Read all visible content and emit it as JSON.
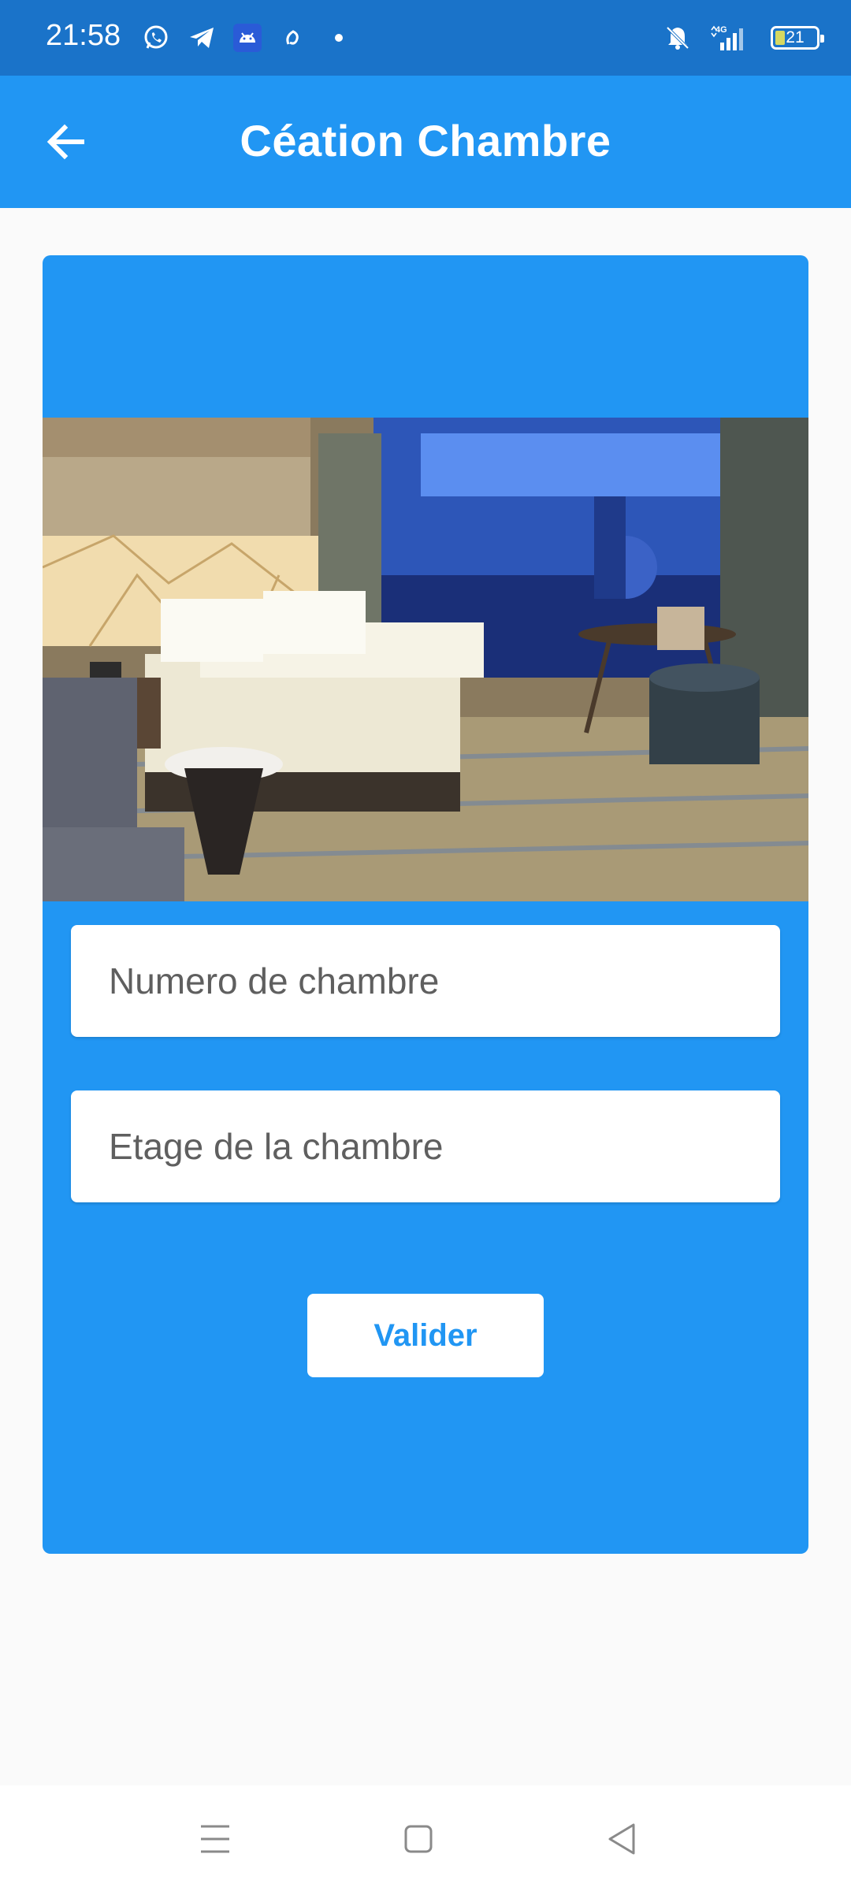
{
  "status_bar": {
    "time": "21:58",
    "battery_level": "21",
    "left_icons": [
      "whatsapp-icon",
      "telegram-icon",
      "android-icon",
      "app-icon",
      "dot-icon"
    ],
    "right_icons": [
      "bell-muted-icon",
      "signal-4g-icon",
      "battery-icon"
    ]
  },
  "app_bar": {
    "title": "Céation Chambre",
    "back_icon": "arrow-left-icon"
  },
  "form": {
    "image_alt": "hotel room",
    "room_number_placeholder": "Numero de chambre",
    "floor_placeholder": "Etage de la chambre",
    "submit_label": "Valider"
  },
  "nav_bar": {
    "icons": [
      "menu-icon",
      "home-icon",
      "back-triangle-icon"
    ]
  },
  "colors": {
    "primary": "#2196f3",
    "status_bar": "#1a73c9",
    "background": "#fafafa"
  }
}
